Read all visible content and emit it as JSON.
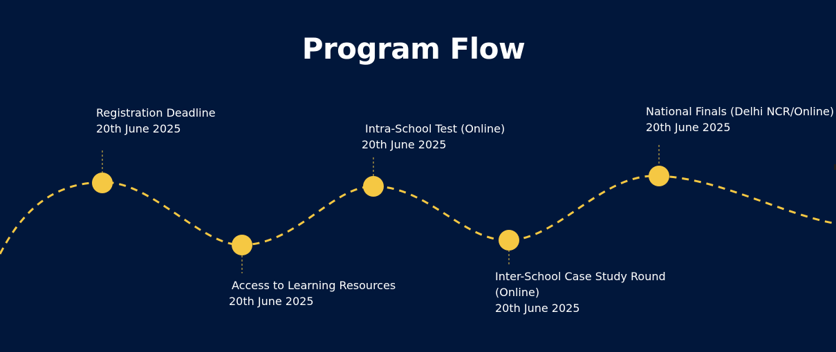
{
  "title": "Program Flow",
  "colors": {
    "background": "#01173b",
    "accent": "#f5c843",
    "text": "#ffffff"
  },
  "milestones": [
    {
      "name": "Registration Deadline",
      "date": "20th June 2025"
    },
    {
      "name": "Access to Learning Resources",
      "date": "20th June 2025"
    },
    {
      "name": "Intra-School Test (Online)",
      "date": "20th June 2025"
    },
    {
      "name": "Inter-School Case Study Round (Online)",
      "date": "20th June 2025"
    },
    {
      "name": "National Finals (Delhi NCR/Online)",
      "date": "20th June 2025"
    }
  ]
}
